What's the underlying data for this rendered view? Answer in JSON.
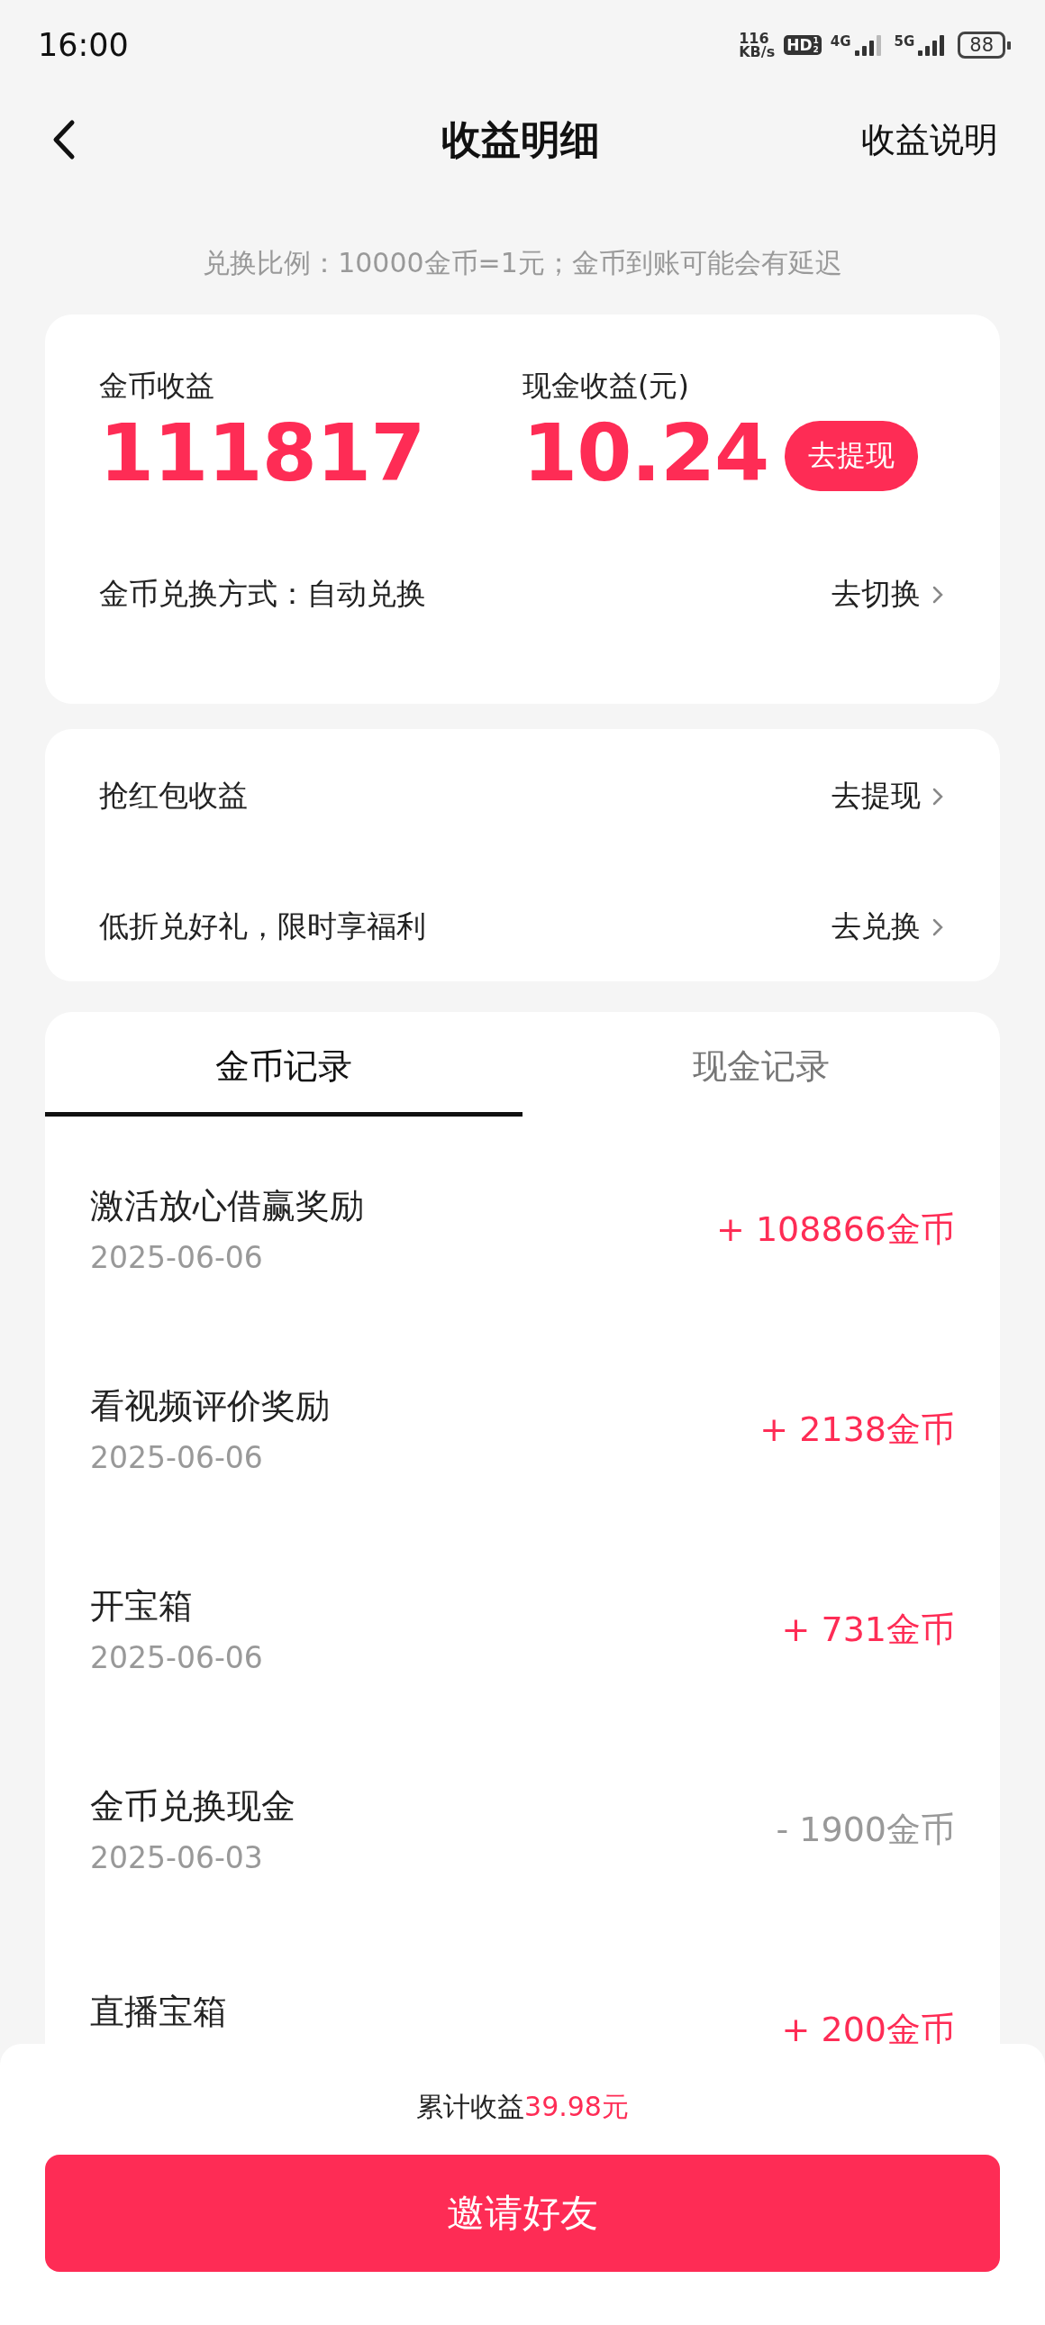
{
  "status_bar": {
    "time": "16:00",
    "speed_value": "116",
    "speed_unit": "KB/s",
    "hd_badge": "HD",
    "hd_sims": [
      "1",
      "2"
    ],
    "networks": [
      "4G",
      "5G"
    ],
    "battery": "88"
  },
  "header": {
    "title": "收益明细",
    "action": "收益说明"
  },
  "hint": "兑换比例：10000金币=1元；金币到账可能会有延迟",
  "summary": {
    "stats": [
      {
        "label": "金币收益",
        "value": "111817"
      },
      {
        "label": "现金收益(元)",
        "value": "10.24"
      }
    ],
    "withdraw_button": "去提现",
    "exchange_mode": {
      "label": "金币兑换方式：自动兑换",
      "action": "去切换"
    }
  },
  "links": [
    {
      "label": "抢红包收益",
      "action": "去提现"
    },
    {
      "label": "低折兑好礼，限时享福利",
      "action": "去兑换"
    }
  ],
  "tabs": [
    {
      "label": "金币记录",
      "selected": true
    },
    {
      "label": "现金记录",
      "selected": false
    }
  ],
  "records": [
    {
      "title": "激活放心借赢奖励",
      "date": "2025-06-06",
      "amount": "+ 108866金币",
      "kind": "income"
    },
    {
      "title": "看视频评价奖励",
      "date": "2025-06-06",
      "amount": "+ 2138金币",
      "kind": "income"
    },
    {
      "title": "开宝箱",
      "date": "2025-06-06",
      "amount": "+ 731金币",
      "kind": "income"
    },
    {
      "title": "金币兑换现金",
      "date": "2025-06-03",
      "amount": "- 1900金币",
      "kind": "expense"
    },
    {
      "title": "直播宝箱",
      "amount": "+ 200金币",
      "kind": "income"
    }
  ],
  "footer": {
    "total_label": "累计收益",
    "total_value": "39.98元",
    "invite_button": "邀请好友"
  }
}
